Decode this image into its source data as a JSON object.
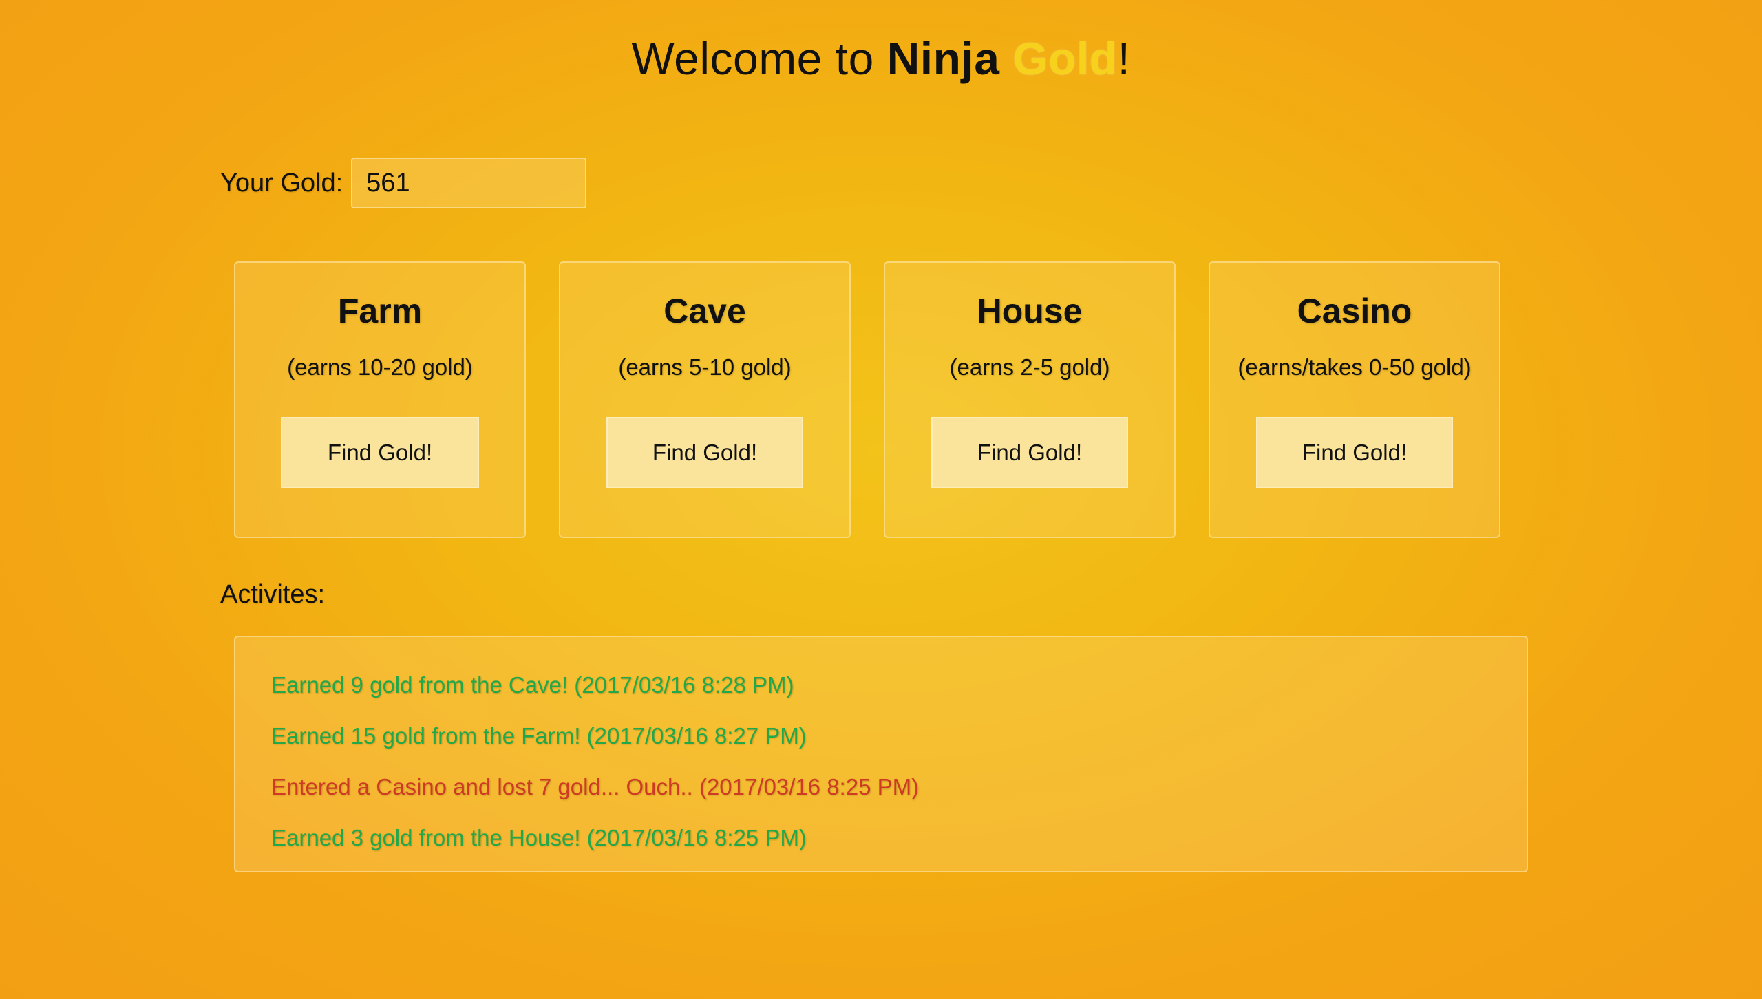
{
  "header": {
    "title_prefix": "Welcome to ",
    "title_ninja": "Ninja",
    "title_gold": "Gold",
    "title_suffix": "!"
  },
  "gold": {
    "label": "Your Gold:",
    "value": "561"
  },
  "locations": [
    {
      "name": "Farm",
      "description": "(earns 10-20 gold)",
      "button_label": "Find Gold!"
    },
    {
      "name": "Cave",
      "description": "(earns 5-10 gold)",
      "button_label": "Find Gold!"
    },
    {
      "name": "House",
      "description": "(earns 2-5 gold)",
      "button_label": "Find Gold!"
    },
    {
      "name": "Casino",
      "description": "(earns/takes 0-50 gold)",
      "button_label": "Find Gold!"
    }
  ],
  "activities": {
    "label": "Activites:",
    "entries": [
      {
        "text": "Earned 9 gold from the Cave! (2017/03/16 8:28 PM)",
        "type": "earned"
      },
      {
        "text": "Earned 15 gold from the Farm! (2017/03/16 8:27 PM)",
        "type": "earned"
      },
      {
        "text": "Entered a Casino and lost 7 gold... Ouch.. (2017/03/16 8:25 PM)",
        "type": "lost"
      },
      {
        "text": "Earned 3 gold from the House! (2017/03/16 8:25 PM)",
        "type": "earned"
      }
    ]
  },
  "colors": {
    "background": "#f2b612",
    "gold_accent": "#f6d21c",
    "earned": "#22a84a",
    "lost": "#cf3a24",
    "button": "#fae39a"
  }
}
